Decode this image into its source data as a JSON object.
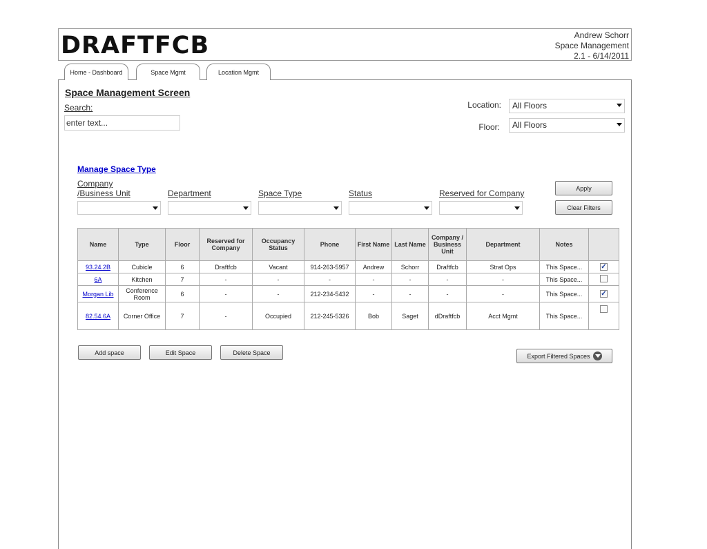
{
  "header": {
    "logo": "DRAFTFCB",
    "user": "Andrew Schorr",
    "app": "Space Management",
    "version": "2.1 - 6/14/2011"
  },
  "tabs": [
    {
      "label": "Home - Dashboard"
    },
    {
      "label": "Space Mgmt"
    },
    {
      "label": "Location Mgmt"
    }
  ],
  "page": {
    "title": "Space Management Screen",
    "search_label": "Search:",
    "search_placeholder": "enter text..."
  },
  "location_filter": {
    "label": "Location:",
    "value": "All Floors"
  },
  "floor_filter": {
    "label": "Floor:",
    "value": "All Floors"
  },
  "manage_link": "Manage Space Type",
  "filters": {
    "company_line1": "Company",
    "company_line2": "/Business Unit",
    "department": "Department",
    "space_type": "Space Type",
    "status": "Status",
    "reserved": "Reserved for Company",
    "apply": "Apply",
    "clear": "Clear Filters"
  },
  "table": {
    "headers": [
      "Name",
      "Type",
      "Floor",
      "Reserved for Company",
      "Occupancy Status",
      "Phone",
      "First Name",
      "Last Name",
      "Company / Business Unit",
      "Department",
      "Notes",
      ""
    ],
    "rows": [
      {
        "name": "93.24.2B",
        "type": "Cubicle",
        "floor": "6",
        "reserved": "Draftfcb",
        "occupancy": "Vacant",
        "phone": "914-263-5957",
        "first": "Andrew",
        "last": "Schorr",
        "company": "Draftfcb",
        "department": "Strat Ops",
        "notes": "This Space...",
        "checked": true
      },
      {
        "name": "6A",
        "type": "Kitchen",
        "floor": "7",
        "reserved": "-",
        "occupancy": "-",
        "phone": "-",
        "first": "-",
        "last": "-",
        "company": "-",
        "department": "-",
        "notes": "This Space...",
        "checked": false
      },
      {
        "name": "Morgan Lib",
        "type": "Conference Room",
        "floor": "6",
        "reserved": "-",
        "occupancy": "-",
        "phone": "212-234-5432",
        "first": "-",
        "last": "-",
        "company": "-",
        "department": "-",
        "notes": "This Space...",
        "checked": true
      },
      {
        "name": "82.54.6A",
        "type": "Corner Office",
        "floor": "7",
        "reserved": "-",
        "occupancy": "Occupied",
        "phone": "212-245-5326",
        "first": "Bob",
        "last": "Saget",
        "company": "dDraftfcb",
        "department": "Acct Mgmt",
        "notes": "This Space...",
        "checked": false
      }
    ]
  },
  "actions": {
    "add": "Add space",
    "edit": "Edit Space",
    "delete": "Delete Space",
    "export": "Export Filtered Spaces"
  },
  "icons": {
    "checkmark": "✓"
  }
}
